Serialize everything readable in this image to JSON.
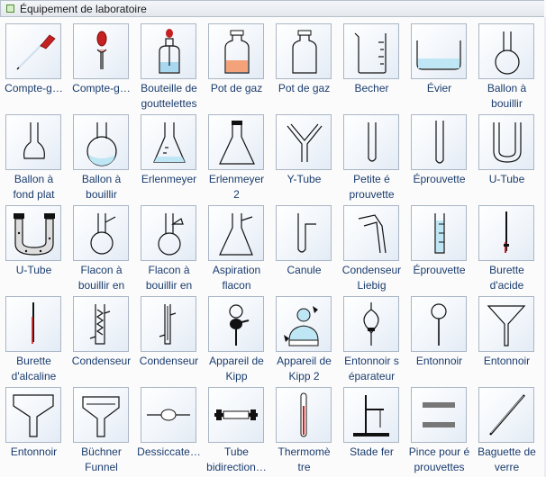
{
  "panel": {
    "title": "Équipement de laboratoire"
  },
  "items": [
    {
      "label": "Compte-g…",
      "icon": "dropper-icon"
    },
    {
      "label": "Compte-g…",
      "icon": "dropper-bulb-icon"
    },
    {
      "label": "Bouteille de\ngouttelettes",
      "icon": "dropper-bottle-icon"
    },
    {
      "label": "Pot de gaz",
      "icon": "gas-jar-filled-icon"
    },
    {
      "label": "Pot de gaz",
      "icon": "gas-jar-icon"
    },
    {
      "label": "Becher",
      "icon": "beaker-icon"
    },
    {
      "label": "Évier",
      "icon": "sink-icon"
    },
    {
      "label": "Ballon à\nbouillir",
      "icon": "boiling-flask-icon"
    },
    {
      "label": "Ballon à\nfond plat",
      "icon": "flat-bottom-flask-icon"
    },
    {
      "label": "Ballon à\nbouillir",
      "icon": "boiling-flask-liquid-icon"
    },
    {
      "label": "Erlenmeyer",
      "icon": "erlenmeyer-icon"
    },
    {
      "label": "Erlenmeyer\n2",
      "icon": "erlenmeyer-stopper-icon"
    },
    {
      "label": "Y-Tube",
      "icon": "y-tube-icon"
    },
    {
      "label": "Petite é\nprouvette",
      "icon": "small-test-tube-icon"
    },
    {
      "label": "Éprouvette",
      "icon": "test-tube-icon"
    },
    {
      "label": "U-Tube",
      "icon": "u-tube-icon"
    },
    {
      "label": "U-Tube",
      "icon": "u-tube-filled-icon"
    },
    {
      "label": "Flacon à\nbouillir en",
      "icon": "flask-side-arm-icon"
    },
    {
      "label": "Flacon à\nbouillir en",
      "icon": "flask-side-arm-2-icon"
    },
    {
      "label": "Aspiration\nflacon",
      "icon": "suction-flask-icon"
    },
    {
      "label": "Canule",
      "icon": "cannula-icon"
    },
    {
      "label": "Condenseur\nLiebig",
      "icon": "liebig-condenser-icon"
    },
    {
      "label": "Éprouvette",
      "icon": "graduated-cylinder-icon"
    },
    {
      "label": "Burette\nd'acide",
      "icon": "acid-burette-icon"
    },
    {
      "label": "Burette\nd'alcaline",
      "icon": "alkaline-burette-icon"
    },
    {
      "label": "Condenseur",
      "icon": "condenser-icon"
    },
    {
      "label": "Condenseur",
      "icon": "condenser-2-icon"
    },
    {
      "label": "Appareil de\nKipp",
      "icon": "kipp-apparatus-icon"
    },
    {
      "label": "Appareil de\nKipp 2",
      "icon": "kipp-apparatus-2-icon"
    },
    {
      "label": "Entonnoir s\néparateur",
      "icon": "separating-funnel-icon"
    },
    {
      "label": "Entonnoir",
      "icon": "thistle-funnel-icon"
    },
    {
      "label": "Entonnoir",
      "icon": "funnel-icon"
    },
    {
      "label": "Entonnoir",
      "icon": "square-funnel-icon"
    },
    {
      "label": "Büchner\nFunnel",
      "icon": "buchner-funnel-icon"
    },
    {
      "label": "Dessiccate…",
      "icon": "desiccator-icon"
    },
    {
      "label": "Tube\nbidirection…",
      "icon": "bidirectional-tube-icon"
    },
    {
      "label": "Thermomè\ntre",
      "icon": "thermometer-icon"
    },
    {
      "label": "Stade fer",
      "icon": "iron-stand-icon"
    },
    {
      "label": "Pince pour é\nprouvettes",
      "icon": "test-tube-clamp-icon"
    },
    {
      "label": "Baguette de\nverre",
      "icon": "glass-rod-icon"
    }
  ]
}
